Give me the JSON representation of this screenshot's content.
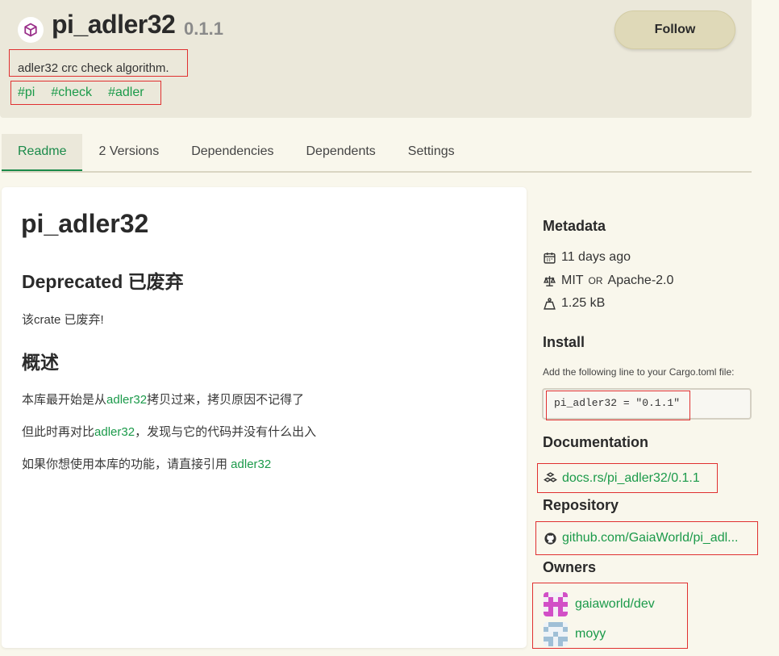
{
  "header": {
    "crate_name": "pi_adler32",
    "version": "0.1.1",
    "follow_label": "Follow",
    "description": "adler32 crc check algorithm.",
    "keywords": [
      "#pi",
      "#check",
      "#adler"
    ]
  },
  "tabs": [
    {
      "label": "Readme",
      "active": true
    },
    {
      "label": "2 Versions",
      "active": false
    },
    {
      "label": "Dependencies",
      "active": false
    },
    {
      "label": "Dependents",
      "active": false
    },
    {
      "label": "Settings",
      "active": false
    }
  ],
  "readme": {
    "title": "pi_adler32",
    "deprecated_heading": "Deprecated 已废弃",
    "deprecated_text": "该crate 已废弃!",
    "overview_heading": "概述",
    "p1_before": "本库最开始是从",
    "p1_link": "adler32",
    "p1_after": "拷贝过来，拷贝原因不记得了",
    "p2_before": "但此时再对比",
    "p2_link": "adler32",
    "p2_after": "，发现与它的代码并没有什么出入",
    "p3_before": "如果你想使用本库的功能，请直接引用 ",
    "p3_link": "adler32"
  },
  "sidebar": {
    "metadata_heading": "Metadata",
    "updated": "11 days ago",
    "license_a": "MIT",
    "license_or": "OR",
    "license_b": "Apache-2.0",
    "size": "1.25 kB",
    "install_heading": "Install",
    "install_hint": "Add the following line to your Cargo.toml file:",
    "install_code": "pi_adler32 = \"0.1.1\"",
    "documentation_heading": "Documentation",
    "documentation_link": "docs.rs/pi_adler32/0.1.1",
    "repository_heading": "Repository",
    "repository_link": "github.com/GaiaWorld/pi_adl...",
    "owners_heading": "Owners",
    "owners": [
      "gaiaworld/dev",
      "moyy"
    ]
  },
  "colors": {
    "accent_green": "#1b9a4a",
    "page_background": "#f9f7ec",
    "header_background": "#ebe8da",
    "annotation_red": "#e03030"
  }
}
